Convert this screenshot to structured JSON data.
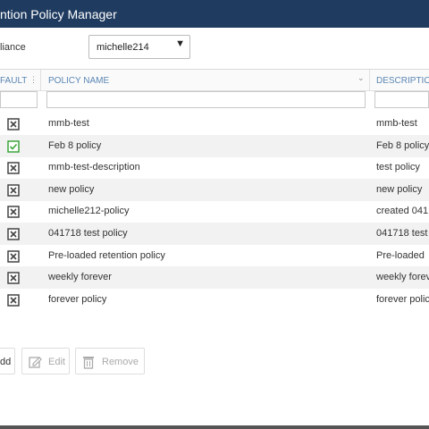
{
  "window": {
    "title": "ntion Policy Manager"
  },
  "appliance": {
    "label": "liance",
    "selected": "michelle214"
  },
  "table": {
    "columns": {
      "default": "FAULT",
      "name": "POLICY NAME",
      "description": "DESCRIPTIO"
    },
    "rows": [
      {
        "checked": false,
        "name": "mmb-test",
        "description": "mmb-test"
      },
      {
        "checked": true,
        "name": "Feb 8 policy",
        "description": "Feb 8 policy"
      },
      {
        "checked": false,
        "name": "mmb-test-description",
        "description": "test policy"
      },
      {
        "checked": false,
        "name": "new policy",
        "description": "new policy"
      },
      {
        "checked": false,
        "name": "michelle212-policy",
        "description": "created 041"
      },
      {
        "checked": false,
        "name": "041718 test policy",
        "description": "041718 test"
      },
      {
        "checked": false,
        "name": "Pre-loaded retention policy",
        "description": "Pre-loaded"
      },
      {
        "checked": false,
        "name": "weekly forever",
        "description": "weekly forev"
      },
      {
        "checked": false,
        "name": "forever policy",
        "description": "forever polic"
      }
    ]
  },
  "toolbar": {
    "add_label": "dd",
    "edit_label": "Edit",
    "remove_label": "Remove"
  },
  "colors": {
    "titlebar": "#1f3b60",
    "header_text": "#5b87b4",
    "check_green": "#3aa53a"
  }
}
